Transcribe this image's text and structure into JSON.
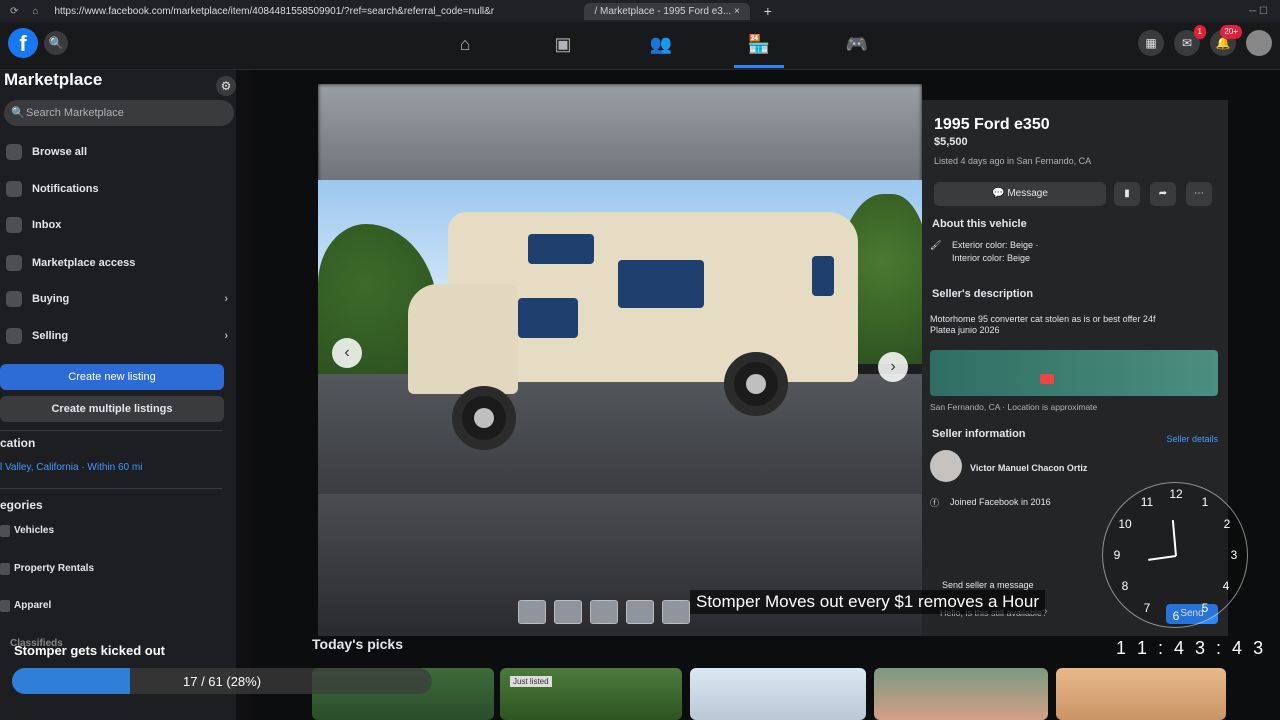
{
  "browser": {
    "url": "https://www.facebook.com/marketplace/item/408448155850990​1/?ref=search&referral_code=null&referral_story_type=post&tracking=browse_serp%3Ad570efa7-2c29-4a6b-8d72-661603ebd456",
    "tab_title": "/ Marketplace - 1995 Ford e3...",
    "close_label": "×",
    "new_tab_label": "+"
  },
  "header": {
    "logo": "f",
    "badges": {
      "messages": "1",
      "notifications": "20+"
    }
  },
  "sidebar": {
    "title": "Marketplace",
    "search_placeholder": "Search Marketplace",
    "items": [
      {
        "label": "Browse all"
      },
      {
        "label": "Notifications"
      },
      {
        "label": "Inbox"
      },
      {
        "label": "Marketplace access"
      },
      {
        "label": "Buying"
      },
      {
        "label": "Selling"
      }
    ],
    "create_listing": "Create new listing",
    "create_multiple": "Create multiple listings",
    "location_heading": "cation",
    "location_value": "l Valley, California · Within 60 mi",
    "categories_heading": "egories",
    "categories": [
      "Vehicles",
      "Property Rentals",
      "Apparel",
      "Classifieds"
    ]
  },
  "listing": {
    "title": "1995 Ford e350",
    "price": "$5,500",
    "listed": "Listed 4 days ago in San Fernando, CA",
    "message_button": "Message",
    "about_heading": "About this vehicle",
    "exterior": "Exterior color: Beige ·",
    "interior": "Interior color: Beige",
    "desc_heading": "Seller's description",
    "desc_line1": "Motorhome 95 converter cat stolen as is or best offer 24f",
    "desc_line2": "Platea junio 2026",
    "location_note": "San Fernando, CA · Location is approximate",
    "seller_heading": "Seller information",
    "seller_details": "Seller details",
    "seller_name": "Victor Manuel Chacon Ortiz",
    "joined": "Joined Facebook in 2016",
    "send_message": "Send seller a message",
    "message_text": "Hello, is this still available?",
    "send_label": "Send"
  },
  "feed": {
    "picks_heading": "Today's picks",
    "pick_label": "Just listed"
  },
  "overlay": {
    "caption": "Stomper Moves out every $1 removes a Hour",
    "timer": "1 1 : 4 3 : 4 3",
    "progress_label": "Stomper gets kicked out",
    "progress_text": "17 / 61 (28%)",
    "progress_fraction": 0.28,
    "clock_numbers": [
      "12",
      "1",
      "2",
      "3",
      "4",
      "5",
      "6",
      "7",
      "8",
      "9",
      "10",
      "11"
    ]
  },
  "colors": {
    "accent": "#2d88ff",
    "fb_blue": "#1877f2",
    "progress": "#2e7fd8"
  }
}
